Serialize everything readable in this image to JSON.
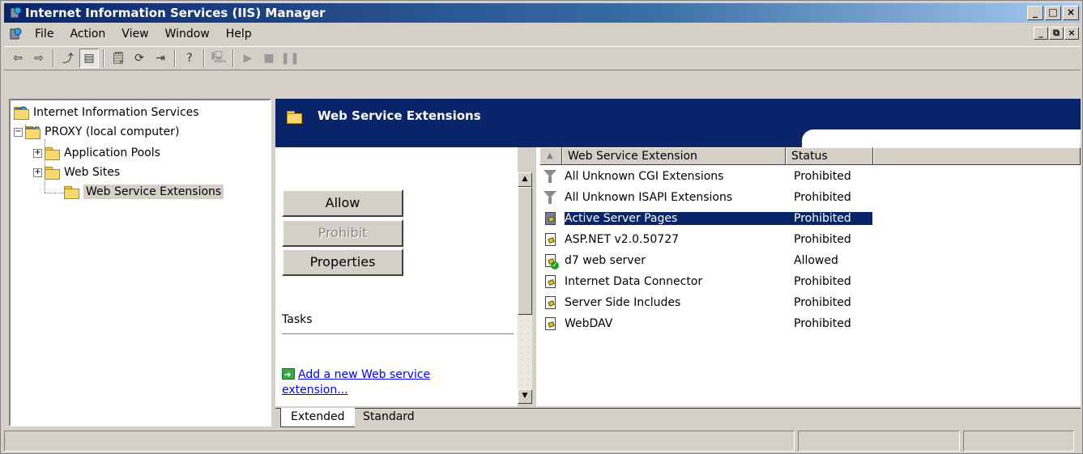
{
  "window": {
    "title": "Internet Information Services (IIS) Manager",
    "minimize_label": "_",
    "maximize_label": "□",
    "close_label": "×"
  },
  "menu": {
    "items": [
      "File",
      "Action",
      "View",
      "Window",
      "Help"
    ],
    "mdi_minimize": "_",
    "mdi_restore": "⧉",
    "mdi_close": "×"
  },
  "toolbar": {
    "back": "⇦",
    "forward": "⇨",
    "up": "⤴",
    "show_hide": "▤",
    "properties": "🗒",
    "refresh": "⟳",
    "export": "⇥",
    "help": "?",
    "computer": "🖳",
    "play": "▶",
    "stop": "■",
    "pause": "❚❚"
  },
  "tree": {
    "root": "Internet Information Services",
    "computer": "PROXY (local computer)",
    "items": [
      "Application Pools",
      "Web Sites",
      "Web Service Extensions"
    ],
    "expand_minus": "−",
    "expand_plus": "+"
  },
  "header": {
    "title": "Web Service Extensions"
  },
  "taskpane": {
    "allow": "Allow",
    "prohibit": "Prohibit",
    "properties": "Properties",
    "tasks_label": "Tasks",
    "add_link": "Add a new Web service extension..."
  },
  "list": {
    "columns": [
      "Web Service Extension",
      "Status"
    ],
    "sort_indicator": "▲",
    "rows": [
      {
        "name": "All Unknown CGI Extensions",
        "status": "Prohibited",
        "icon": "funnel-icon"
      },
      {
        "name": "All Unknown ISAPI Extensions",
        "status": "Prohibited",
        "icon": "funnel-icon"
      },
      {
        "name": "Active Server Pages",
        "status": "Prohibited",
        "icon": "document-icon",
        "selected": true
      },
      {
        "name": "ASP.NET v2.0.50727",
        "status": "Prohibited",
        "icon": "document-icon"
      },
      {
        "name": "d7 web server",
        "status": "Allowed",
        "icon": "document-allowed-icon"
      },
      {
        "name": "Internet Data Connector",
        "status": "Prohibited",
        "icon": "document-icon"
      },
      {
        "name": "Server Side Includes",
        "status": "Prohibited",
        "icon": "document-icon"
      },
      {
        "name": "WebDAV",
        "status": "Prohibited",
        "icon": "document-icon"
      }
    ]
  },
  "scrollbar": {
    "up": "▲",
    "down": "▼"
  },
  "tabs": [
    "Extended",
    "Standard"
  ],
  "colors": {
    "titlebar_start": "#0a246a",
    "titlebar_end": "#a6caf0",
    "face": "#d4d0c8",
    "header": "#0a246a",
    "link": "#0000ee",
    "selection": "#0a246a"
  }
}
